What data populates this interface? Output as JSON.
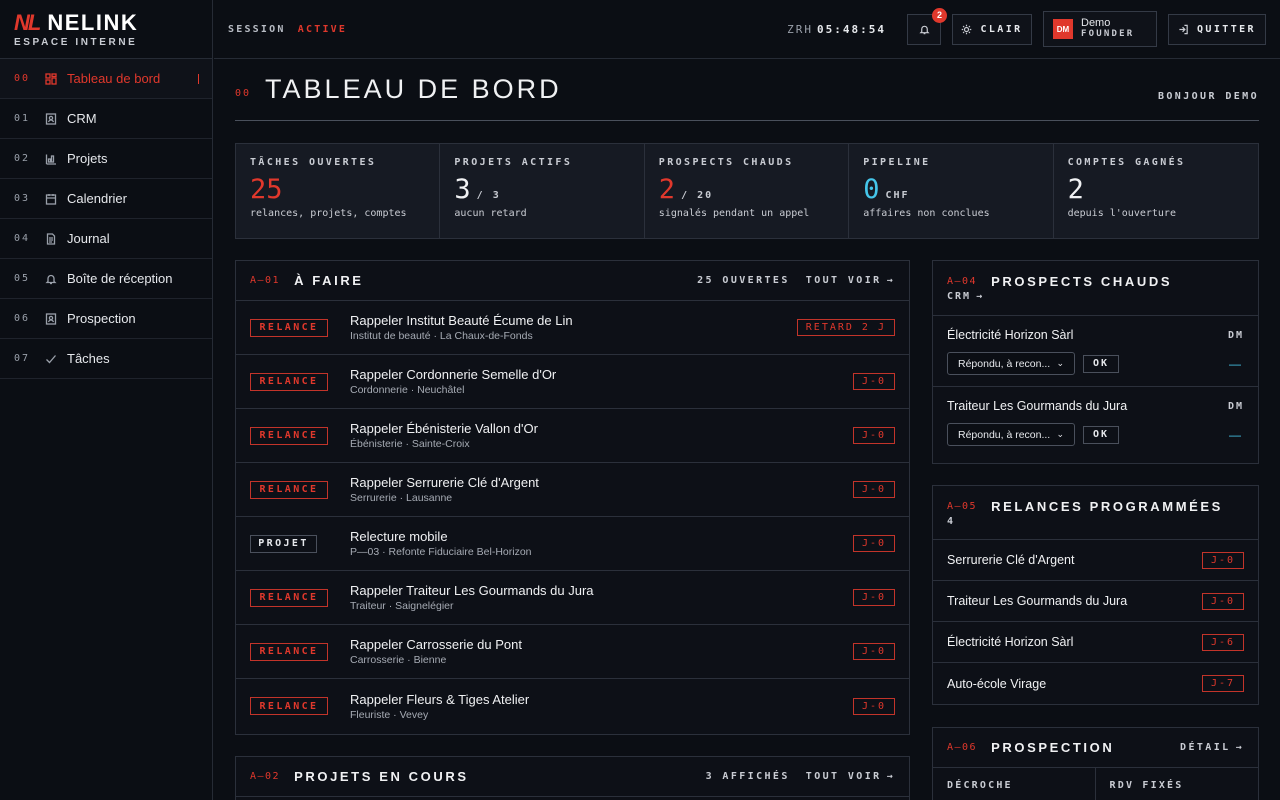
{
  "brand": {
    "logo": "NL",
    "name": "NELINK",
    "subtitle": "ESPACE INTERNE"
  },
  "nav": [
    {
      "num": "00",
      "label": "Tableau de bord",
      "icon": "dashboard-icon",
      "active": true
    },
    {
      "num": "01",
      "label": "CRM",
      "icon": "contacts-icon"
    },
    {
      "num": "02",
      "label": "Projets",
      "icon": "projects-icon"
    },
    {
      "num": "03",
      "label": "Calendrier",
      "icon": "calendar-icon"
    },
    {
      "num": "04",
      "label": "Journal",
      "icon": "document-icon"
    },
    {
      "num": "05",
      "label": "Boîte de réception",
      "icon": "bell-icon"
    },
    {
      "num": "06",
      "label": "Prospection",
      "icon": "contacts-icon"
    },
    {
      "num": "07",
      "label": "Tâches",
      "icon": "check-icon"
    }
  ],
  "topbar": {
    "session_label": "SESSION",
    "session_status": "ACTIVE",
    "clock_zone": "ZRH",
    "clock_time": "05:48:54",
    "notif_count": "2",
    "theme_label": "CLAIR",
    "user_initials": "DM",
    "user_name": "Demo",
    "user_role": "FOUNDER",
    "quit_label": "QUITTER"
  },
  "page": {
    "num": "00",
    "title": "TABLEAU DE BORD",
    "greeting": "BONJOUR DEMO"
  },
  "kpis": [
    {
      "label": "TÂCHES OUVERTES",
      "value": "25",
      "unit": "",
      "sub": "relances, projets, comptes",
      "tone": "red"
    },
    {
      "label": "PROJETS ACTIFS",
      "value": "3",
      "unit": "/ 3",
      "sub": "aucun retard",
      "tone": ""
    },
    {
      "label": "PROSPECTS CHAUDS",
      "value": "2",
      "unit": "/ 20",
      "sub": "signalés pendant un appel",
      "tone": "red"
    },
    {
      "label": "PIPELINE",
      "value": "0",
      "unit": "CHF",
      "sub": "affaires non conclues",
      "tone": "cyan"
    },
    {
      "label": "COMPTES GAGNÉS",
      "value": "2",
      "unit": "",
      "sub": "depuis l'ouverture",
      "tone": ""
    }
  ],
  "todo": {
    "code": "A—01",
    "title": "À FAIRE",
    "count": "25 OUVERTES",
    "see_all": "TOUT VOIR",
    "items": [
      {
        "tag": "RELANCE",
        "title": "Rappeler Institut Beauté Écume de Lin",
        "sub": "Institut de beauté · La Chaux-de-Fonds",
        "due": "RETARD 2 J",
        "kind": "relance"
      },
      {
        "tag": "RELANCE",
        "title": "Rappeler Cordonnerie Semelle d'Or",
        "sub": "Cordonnerie · Neuchâtel",
        "due": "J-0",
        "kind": "relance"
      },
      {
        "tag": "RELANCE",
        "title": "Rappeler Ébénisterie Vallon d'Or",
        "sub": "Ébénisterie · Sainte-Croix",
        "due": "J-0",
        "kind": "relance"
      },
      {
        "tag": "RELANCE",
        "title": "Rappeler Serrurerie Clé d'Argent",
        "sub": "Serrurerie · Lausanne",
        "due": "J-0",
        "kind": "relance"
      },
      {
        "tag": "PROJET",
        "title": "Relecture mobile",
        "sub": "P—03 · Refonte Fiduciaire Bel-Horizon",
        "due": "J-0",
        "kind": "projet"
      },
      {
        "tag": "RELANCE",
        "title": "Rappeler Traiteur Les Gourmands du Jura",
        "sub": "Traiteur · Saignelégier",
        "due": "J-0",
        "kind": "relance"
      },
      {
        "tag": "RELANCE",
        "title": "Rappeler Carrosserie du Pont",
        "sub": "Carrosserie · Bienne",
        "due": "J-0",
        "kind": "relance"
      },
      {
        "tag": "RELANCE",
        "title": "Rappeler Fleurs & Tiges Atelier",
        "sub": "Fleuriste · Vevey",
        "due": "J-0",
        "kind": "relance"
      }
    ]
  },
  "projects": {
    "code": "A—02",
    "title": "PROJETS EN COURS",
    "count": "3 AFFICHÉS",
    "see_all": "TOUT VOIR"
  },
  "hot_prospects": {
    "code": "A—04",
    "title": "PROSPECTS CHAUDS",
    "sub": "CRM",
    "items": [
      {
        "name": "Électricité Horizon Sàrl",
        "initials": "DM",
        "select": "Répondu, à recon...",
        "ok": "OK",
        "dash": "—"
      },
      {
        "name": "Traiteur Les Gourmands du Jura",
        "initials": "DM",
        "select": "Répondu, à recon...",
        "ok": "OK",
        "dash": "—"
      }
    ]
  },
  "followups": {
    "code": "A—05",
    "title": "RELANCES PROGRAMMÉES",
    "count": "4",
    "items": [
      {
        "name": "Serrurerie Clé d'Argent",
        "due": "J-0"
      },
      {
        "name": "Traiteur Les Gourmands du Jura",
        "due": "J-0"
      },
      {
        "name": "Électricité Horizon Sàrl",
        "due": "J-6"
      },
      {
        "name": "Auto-école Virage",
        "due": "J-7"
      }
    ]
  },
  "prospection": {
    "code": "A—06",
    "title": "PROSPECTION",
    "detail": "DÉTAIL",
    "col1": "DÉCROCHE",
    "col2": "RDV FIXÉS"
  },
  "colors": {
    "accent": "#e0382c",
    "cyan": "#45c6ea",
    "bg": "#0b0e14",
    "panel": "#161a23"
  }
}
